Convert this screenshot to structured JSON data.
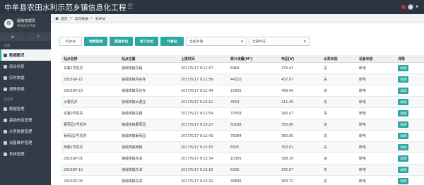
{
  "app": {
    "title": "中牟县农田水利示范乡镇信息化工程"
  },
  "sidebar": {
    "profile": {
      "name": "超级管理员",
      "org": "中牟县水务局"
    },
    "section_common": "常用",
    "items_common": [
      {
        "label": "数据概况",
        "active": true
      },
      {
        "label": "综合信息"
      },
      {
        "label": "实时数据"
      },
      {
        "label": "报警数据"
      }
    ],
    "section_main": "主菜单",
    "items_main": [
      {
        "label": "数据管理"
      },
      {
        "label": "基础信息管理"
      },
      {
        "label": "水务数据管理"
      },
      {
        "label": "设备维护管理"
      },
      {
        "label": "系统管理"
      }
    ]
  },
  "breadcrumb": {
    "items": [
      "首页",
      "实时数据",
      "机井站"
    ]
  },
  "filters": {
    "tabs": [
      "机井站",
      "墒情监测",
      "渠道水站",
      "地下水位",
      "气象站"
    ],
    "town_select": "全部乡镇",
    "village_select": "全部村庄"
  },
  "table": {
    "columns": [
      "站点名称",
      "站点位置",
      "上报时间",
      "累计流量[M³]",
      "电压[V]",
      "水泵状态",
      "设备状态",
      "详情"
    ],
    "details_label": "详情",
    "rows": [
      {
        "name": "东路1号机井",
        "location": "狼城岗镇东路",
        "time": "2017/5/17 9:12:57",
        "flow": "8469",
        "voltage": "379.41",
        "pump": "关",
        "device": "断电"
      },
      {
        "name": "2015GP-22",
        "location": "狼城岗镇青谷寺",
        "time": "2017/5/17 9:12:59",
        "flow": "44310",
        "voltage": "457.07",
        "pump": "关",
        "device": "断电"
      },
      {
        "name": "2015GP-23",
        "location": "狼城岗镇青谷寺",
        "time": "2017/5/17 9:12:44",
        "flow": "10835",
        "voltage": "458.44",
        "pump": "关",
        "device": "断电"
      },
      {
        "name": "大曹机井",
        "location": "狼城岗镇大曹庄",
        "time": "2017/5/17 9:13:11",
        "flow": "4554",
        "voltage": "411.49",
        "pump": "关",
        "device": "断电"
      },
      {
        "name": "东路3号机井",
        "location": "狼城岗镇东路",
        "time": "2017/5/17 9:12:54",
        "flow": "37559",
        "voltage": "390.47",
        "pump": "关",
        "device": "断电"
      },
      {
        "name": "葡萄园1号机井",
        "location": "狼城岗镇葡萄园",
        "time": "2017/5/17 9:13:27",
        "flow": "50188",
        "voltage": "355.80",
        "pump": "关",
        "device": "断电"
      },
      {
        "name": "葡萄园2号机井",
        "location": "狼城岗镇葡萄园",
        "time": "2017/5/17 9:12:43",
        "flow": "78284",
        "voltage": "360.85",
        "pump": "关",
        "device": "断电"
      },
      {
        "name": "西路1号机井",
        "location": "狼城岗镇西路",
        "time": "2017/5/17 9:13:15",
        "flow": "6505",
        "voltage": "393.61",
        "pump": "关",
        "device": "断电"
      },
      {
        "name": "2015GP-01",
        "location": "狼城岗镇东漳",
        "time": "2017/5/17 9:13:34",
        "flow": "10305",
        "voltage": "398.39",
        "pump": "关",
        "device": "断电"
      },
      {
        "name": "2015GP-10",
        "location": "狼城岗镇东漳",
        "time": "2017/5/17 9:13:16",
        "flow": "6356",
        "voltage": "355.67",
        "pump": "关",
        "device": "断电"
      },
      {
        "name": "2015GP-09",
        "location": "狼城岗镇东漳",
        "time": "2017/5/17 9:13:22",
        "flow": "39846",
        "voltage": "369.72",
        "pump": "关",
        "device": "断电"
      }
    ]
  }
}
